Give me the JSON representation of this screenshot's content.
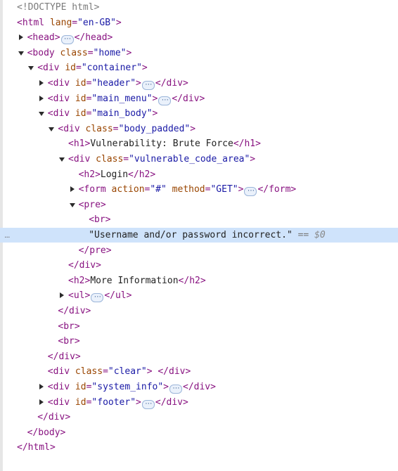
{
  "dom_tree": {
    "selected_row_marker": "...",
    "selected_console_ref": "$0",
    "equals_sign": "==",
    "ellipsis_glyph": "⋯",
    "rows": [
      {
        "doctype": "<!DOCTYPE html>"
      },
      {
        "tag": "html",
        "attrs": [
          {
            "name": "lang",
            "value": "\"en-GB\""
          }
        ]
      },
      {
        "tag": "head",
        "collapsed": true
      },
      {
        "tag": "body",
        "attrs": [
          {
            "name": "class",
            "value": "\"home\""
          }
        ]
      },
      {
        "tag": "div",
        "attrs": [
          {
            "name": "id",
            "value": "\"container\""
          }
        ]
      },
      {
        "tag": "div",
        "attrs": [
          {
            "name": "id",
            "value": "\"header\""
          }
        ],
        "collapsed": true
      },
      {
        "tag": "div",
        "attrs": [
          {
            "name": "id",
            "value": "\"main_menu\""
          }
        ],
        "collapsed": true
      },
      {
        "tag": "div",
        "attrs": [
          {
            "name": "id",
            "value": "\"main_body\""
          }
        ]
      },
      {
        "tag": "div",
        "attrs": [
          {
            "name": "class",
            "value": "\"body_padded\""
          }
        ]
      },
      {
        "tag": "h1",
        "text": "Vulnerability: Brute Force"
      },
      {
        "tag": "div",
        "attrs": [
          {
            "name": "class",
            "value": "\"vulnerable_code_area\""
          }
        ]
      },
      {
        "tag": "h2",
        "text": "Login"
      },
      {
        "tag": "form",
        "attrs": [
          {
            "name": "action",
            "value": "\"#\""
          },
          {
            "name": "method",
            "value": "\"GET\""
          }
        ],
        "collapsed": true
      },
      {
        "tag": "pre"
      },
      {
        "tag": "br"
      },
      {
        "text_node": "\"Username and/or password incorrect.\""
      },
      {
        "close": "pre"
      },
      {
        "close": "div"
      },
      {
        "tag": "h2",
        "text": "More Information"
      },
      {
        "tag": "ul",
        "collapsed": true
      },
      {
        "close": "div"
      },
      {
        "tag": "br"
      },
      {
        "tag": "br"
      },
      {
        "close": "div"
      },
      {
        "tag": "div",
        "attrs": [
          {
            "name": "class",
            "value": "\"clear\""
          }
        ],
        "text": " "
      },
      {
        "tag": "div",
        "attrs": [
          {
            "name": "id",
            "value": "\"system_info\""
          }
        ],
        "collapsed": true
      },
      {
        "tag": "div",
        "attrs": [
          {
            "name": "id",
            "value": "\"footer\""
          }
        ],
        "collapsed": true
      },
      {
        "close": "div"
      },
      {
        "close": "body"
      },
      {
        "close": "html"
      }
    ]
  }
}
